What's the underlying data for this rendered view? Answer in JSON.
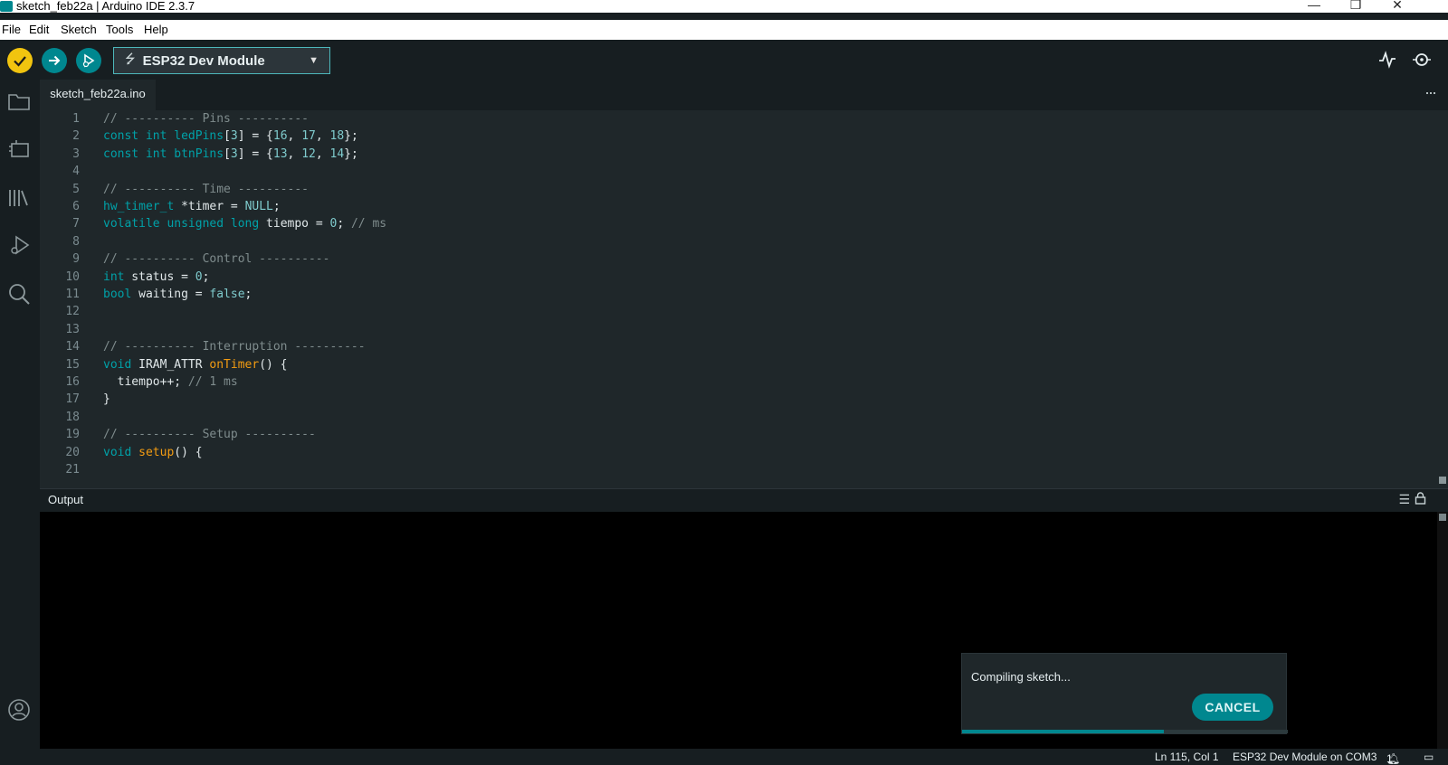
{
  "window": {
    "title": "sketch_feb22a | Arduino IDE 2.3.7",
    "controls": {
      "minimize": "—",
      "restore": "❐",
      "close": "✕"
    }
  },
  "menu": [
    "File",
    "Edit",
    "Sketch",
    "Tools",
    "Help"
  ],
  "toolbar": {
    "verify_icon": "check-icon",
    "upload_icon": "arrow-right-icon",
    "debug_icon": "debug-icon",
    "board": "ESP32 Dev Module",
    "serial_plotter_icon": "plotter-icon",
    "serial_monitor_icon": "monitor-icon"
  },
  "sidebar": [
    "folder-icon",
    "board-icon",
    "library-icon",
    "debug-icon",
    "search-icon",
    "account-icon"
  ],
  "tab": {
    "label": "sketch_feb22a.ino",
    "more": "···"
  },
  "code": [
    {
      "n": "1",
      "t": "// ---------- Pins ----------"
    },
    {
      "n": "2",
      "t": "const int ledPins[3] = {16, 17, 18};"
    },
    {
      "n": "3",
      "t": "const int btnPins[3] = {13, 12, 14};"
    },
    {
      "n": "4",
      "t": ""
    },
    {
      "n": "5",
      "t": "// ---------- Time ----------"
    },
    {
      "n": "6",
      "t": "hw_timer_t *timer = NULL;"
    },
    {
      "n": "7",
      "t": "volatile unsigned long tiempo = 0; // ms"
    },
    {
      "n": "8",
      "t": ""
    },
    {
      "n": "9",
      "t": "// ---------- Control ----------"
    },
    {
      "n": "10",
      "t": "int status = 0;"
    },
    {
      "n": "11",
      "t": "bool waiting = false;"
    },
    {
      "n": "12",
      "t": ""
    },
    {
      "n": "13",
      "t": ""
    },
    {
      "n": "14",
      "t": "// ---------- Interruption ----------"
    },
    {
      "n": "15",
      "t": "void IRAM_ATTR onTimer() {"
    },
    {
      "n": "16",
      "t": "  tiempo++; // 1 ms"
    },
    {
      "n": "17",
      "t": "}"
    },
    {
      "n": "18",
      "t": ""
    },
    {
      "n": "19",
      "t": "// ---------- Setup ----------"
    },
    {
      "n": "20",
      "t": "void setup() {"
    },
    {
      "n": "21",
      "t": ""
    }
  ],
  "output": {
    "title": "Output",
    "clear_icon": "clear-icon",
    "lock_icon": "lock-icon"
  },
  "notification": {
    "message": "Compiling sketch...",
    "cancel": "CANCEL",
    "progress": 0.62
  },
  "status": {
    "position": "Ln 115, Col 1",
    "board_port": "ESP32 Dev Module on COM3",
    "notifications_count": "1"
  },
  "colors": {
    "accent": "#00878f",
    "verify": "#f1c40f",
    "background": "#171e21",
    "editor": "#1f272a"
  }
}
